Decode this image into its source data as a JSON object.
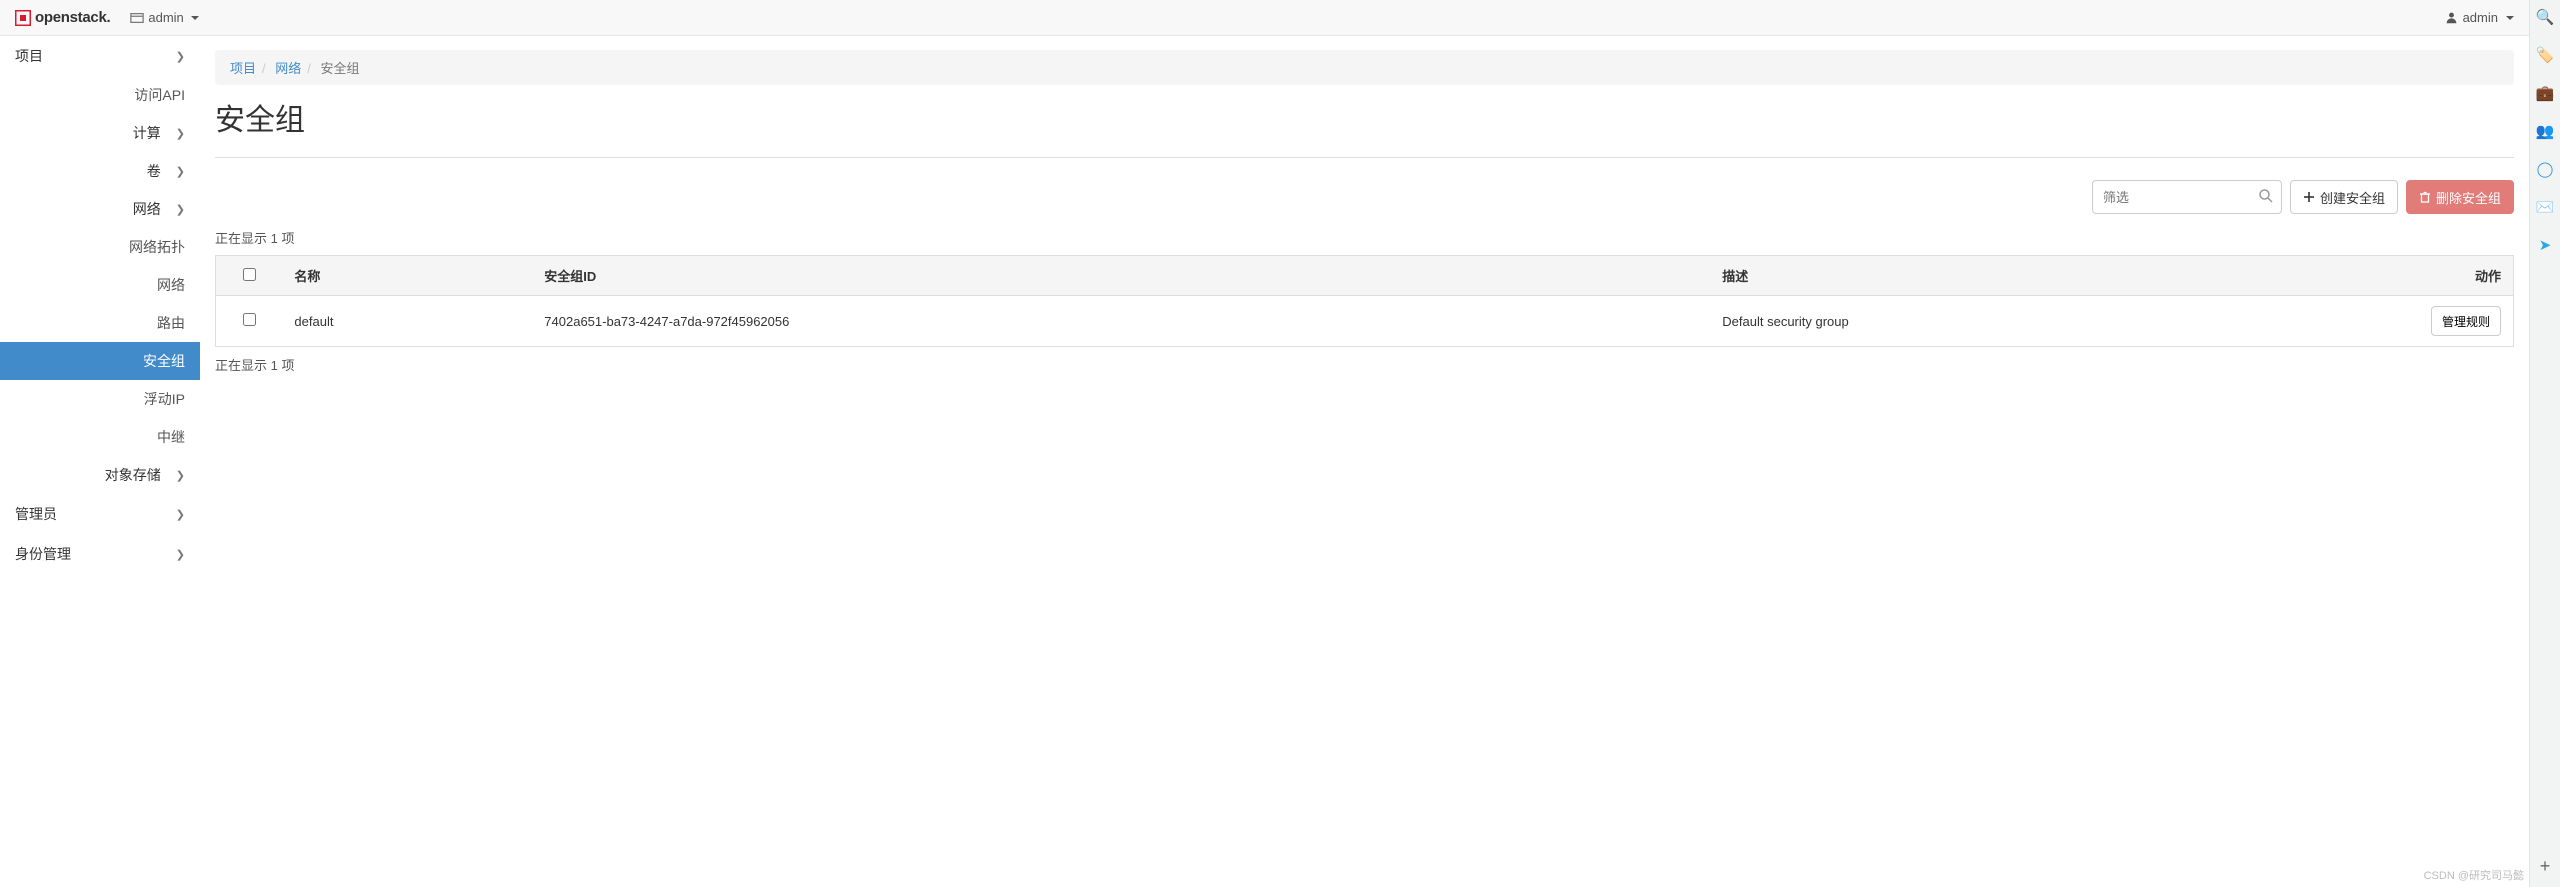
{
  "header": {
    "brand": "openstack.",
    "project_selector": "admin",
    "user": "admin"
  },
  "sidebar": {
    "project": "项目",
    "api": "访问API",
    "compute": "计算",
    "volume": "卷",
    "network": "网络",
    "net_sub": {
      "topology": "网络拓扑",
      "networks": "网络",
      "routers": "路由",
      "sec_groups": "安全组",
      "floating_ip": "浮动IP",
      "relay": "中继"
    },
    "object_storage": "对象存储",
    "admin": "管理员",
    "identity": "身份管理"
  },
  "breadcrumb": {
    "l1": "项目",
    "l2": "网络",
    "l3": "安全组"
  },
  "page_title": "安全组",
  "search": {
    "placeholder": "筛选"
  },
  "buttons": {
    "create": "创建安全组",
    "delete": "删除安全组",
    "manage": "管理规则"
  },
  "table": {
    "count_top": "正在显示 1 项",
    "count_bottom": "正在显示 1 项",
    "headers": {
      "name": "名称",
      "id": "安全组ID",
      "desc": "描述",
      "action": "动作"
    },
    "rows": [
      {
        "name": "default",
        "id": "7402a651-ba73-4247-a7da-972f45962056",
        "desc": "Default security group"
      }
    ]
  },
  "watermark": "CSDN @研究司马懿"
}
